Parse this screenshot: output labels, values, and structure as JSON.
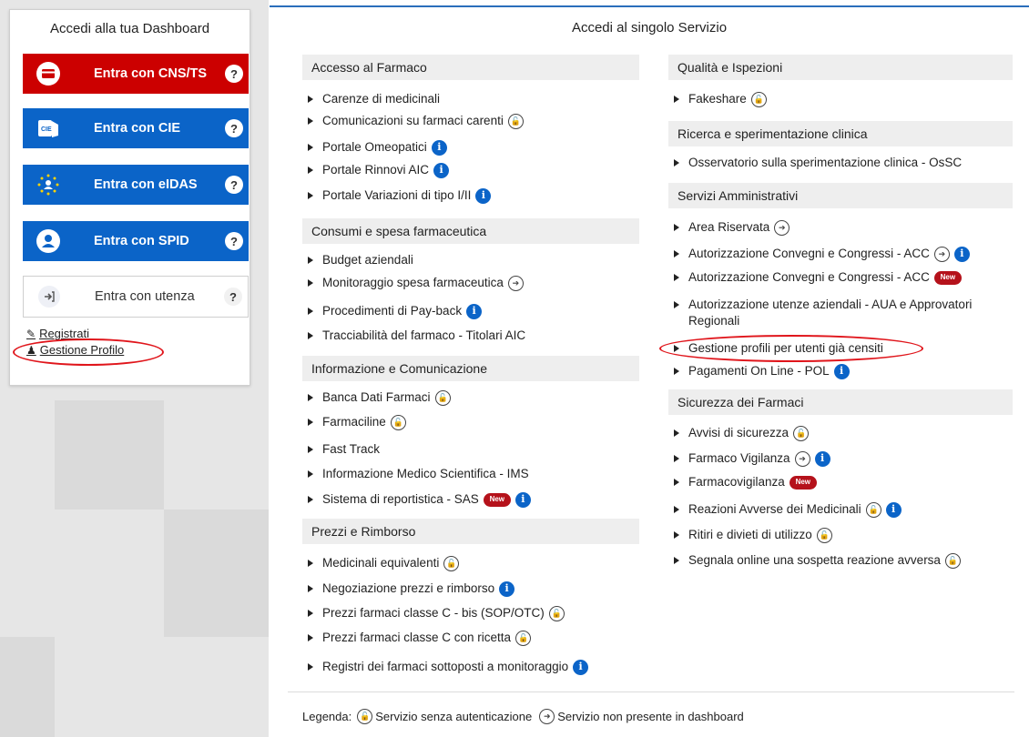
{
  "dashboard": {
    "title": "Accedi alla tua Dashboard",
    "buttons": [
      {
        "label": "Entra con CNS/TS",
        "help": "?",
        "icon": "smartcard-icon"
      },
      {
        "label": "Entra con CIE",
        "help": "?",
        "icon": "cie-card-icon"
      },
      {
        "label": "Entra con eIDAS",
        "help": "?",
        "icon": "eidas-stars-icon"
      },
      {
        "label": "Entra con SPID",
        "help": "?",
        "icon": "spid-user-icon"
      },
      {
        "label": "Entra con utenza",
        "help": "?",
        "icon": "login-arrow-icon"
      }
    ],
    "links": [
      {
        "label": "Registrati",
        "icon": "edit-icon"
      },
      {
        "label": "Gestione Profilo",
        "icon": "user-icon"
      }
    ]
  },
  "content": {
    "title": "Accedi al singolo Servizio",
    "left_sections": [
      {
        "title": "Accesso al Farmaco",
        "items": [
          {
            "label": "Carenze di medicinali",
            "badges": []
          },
          {
            "label": "Comunicazioni su farmaci carenti",
            "badges": [
              "lock"
            ]
          },
          {
            "label": "Portale Omeopatici",
            "badges": [
              "info"
            ]
          },
          {
            "label": "Portale Rinnovi AIC",
            "badges": [
              "info"
            ]
          },
          {
            "label": "Portale Variazioni di tipo I/II",
            "badges": [
              "info"
            ]
          }
        ]
      },
      {
        "title": "Consumi e spesa farmaceutica",
        "items": [
          {
            "label": "Budget aziendali",
            "badges": []
          },
          {
            "label": "Monitoraggio spesa farmaceutica",
            "badges": [
              "login"
            ]
          },
          {
            "label": "Procedimenti di Pay-back",
            "badges": [
              "info"
            ]
          },
          {
            "label": "Tracciabilità del farmaco - Titolari AIC",
            "badges": []
          }
        ]
      },
      {
        "title": "Informazione e Comunicazione",
        "items": [
          {
            "label": "Banca Dati Farmaci",
            "badges": [
              "lock"
            ]
          },
          {
            "label": "Farmaciline",
            "badges": [
              "lock"
            ]
          },
          {
            "label": "Fast Track",
            "badges": []
          },
          {
            "label": "Informazione Medico Scientifica - IMS",
            "badges": []
          },
          {
            "label": "Sistema di reportistica - SAS",
            "badges": [
              "new",
              "info"
            ]
          }
        ]
      },
      {
        "title": "Prezzi e Rimborso",
        "items": [
          {
            "label": "Medicinali equivalenti",
            "badges": [
              "lock"
            ]
          },
          {
            "label": "Negoziazione prezzi e rimborso",
            "badges": [
              "info"
            ]
          },
          {
            "label": "Prezzi farmaci classe C - bis (SOP/OTC)",
            "badges": [
              "lock"
            ]
          },
          {
            "label": "Prezzi farmaci classe C con ricetta",
            "badges": [
              "lock"
            ]
          },
          {
            "label": "Registri dei farmaci sottoposti a monitoraggio",
            "badges": [
              "info"
            ]
          }
        ]
      }
    ],
    "right_sections": [
      {
        "title": "Qualità e Ispezioni",
        "items": [
          {
            "label": "Fakeshare",
            "badges": [
              "lock"
            ]
          }
        ]
      },
      {
        "title": "Ricerca e sperimentazione clinica",
        "items": [
          {
            "label": "Osservatorio sulla sperimentazione clinica - OsSC",
            "badges": []
          }
        ]
      },
      {
        "title": "Servizi Amministrativi",
        "items": [
          {
            "label": "Area Riservata",
            "badges": [
              "login"
            ]
          },
          {
            "label": "Autorizzazione Convegni e Congressi - ACC",
            "badges": [
              "login",
              "info"
            ]
          },
          {
            "label": "Autorizzazione Convegni e Congressi - ACC",
            "badges": [
              "new"
            ]
          },
          {
            "label": "Autorizzazione utenze aziendali - AUA e Approvatori Regionali",
            "badges": []
          },
          {
            "label": "Gestione profili per utenti già censiti",
            "badges": []
          },
          {
            "label": "Pagamenti On Line - POL",
            "badges": [
              "info"
            ]
          }
        ]
      },
      {
        "title": "Sicurezza dei Farmaci",
        "items": [
          {
            "label": "Avvisi di sicurezza",
            "badges": [
              "lock"
            ]
          },
          {
            "label": "Farmaco Vigilanza",
            "badges": [
              "login",
              "info"
            ]
          },
          {
            "label": "Farmacovigilanza",
            "badges": [
              "new"
            ]
          },
          {
            "label": "Reazioni Avverse dei Medicinali",
            "badges": [
              "lock",
              "info"
            ]
          },
          {
            "label": "Ritiri e divieti di utilizzo",
            "badges": [
              "lock"
            ]
          },
          {
            "label": "Segnala online una sospetta reazione avversa",
            "badges": [
              "lock"
            ]
          }
        ]
      }
    ],
    "badge_text": {
      "new": "New",
      "info": "i"
    }
  },
  "legend": {
    "label": "Legenda:",
    "lock_text": "Servizio senza autenticazione",
    "login_text": "Servizio non presente in dashboard"
  },
  "colors": {
    "red": "#cc0000",
    "blue": "#0b64c8",
    "annotation": "#e0151b"
  }
}
